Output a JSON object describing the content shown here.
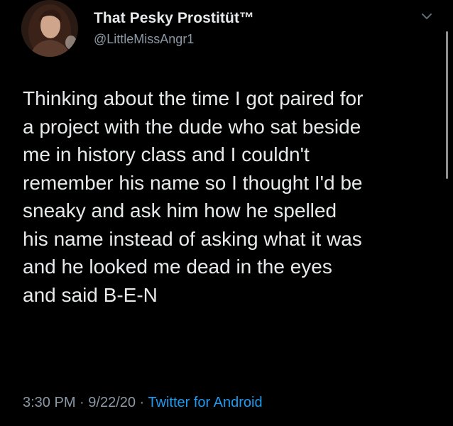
{
  "tweet": {
    "display_name": "That Pesky Prostitüt™",
    "handle": "@LittleMissAngr1",
    "text": "Thinking about the time I got paired for\na project with the dude who sat beside\nme in history class and I couldn't\nremember his name so I thought I'd be\nsneaky and ask him how he spelled\nhis name instead of asking what it was\nand he looked me dead in the eyes\nand said B-E-N",
    "time": "3:30 PM",
    "separator": " · ",
    "date": "9/22/20",
    "source": "Twitter for Android"
  },
  "icons": {
    "avatar": "user-avatar",
    "menu": "chevron-down-icon"
  },
  "colors": {
    "background": "#000000",
    "text": "#e7e9ea",
    "secondary": "#8b98a5",
    "link": "#1d9bf0"
  }
}
